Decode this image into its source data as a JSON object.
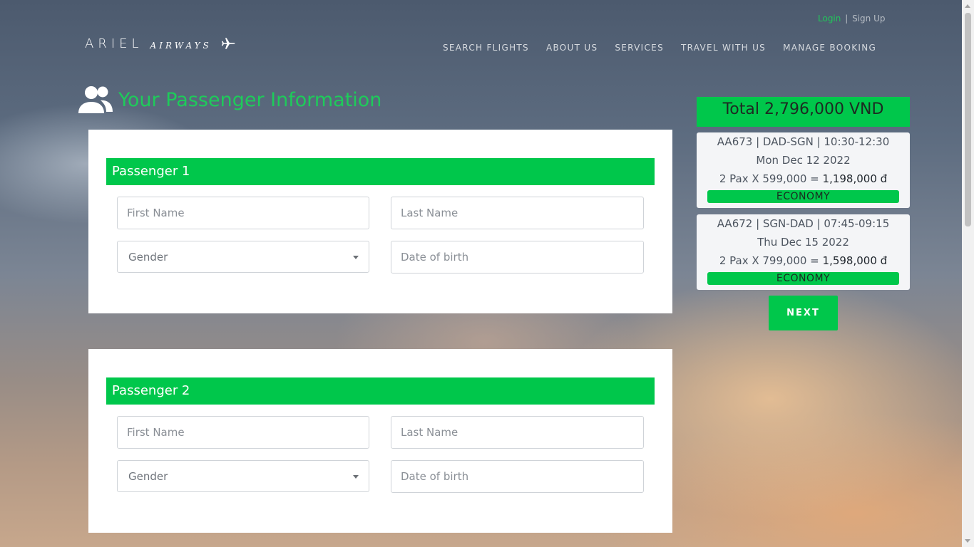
{
  "header": {
    "login": "Login",
    "separator": "|",
    "signup": "Sign Up",
    "logo_main": "ARIEL",
    "logo_sub": "AIRWAYS",
    "logo_icon": "airplane-icon",
    "nav": [
      "SEARCH FLIGHTS",
      "ABOUT US",
      "SERVICES",
      "TRAVEL WITH US",
      "MANAGE BOOKING"
    ]
  },
  "page": {
    "title": "Your Passenger Information",
    "title_icon": "users-icon"
  },
  "passengers": [
    {
      "heading": "Passenger 1",
      "first_name_placeholder": "First Name",
      "last_name_placeholder": "Last Name",
      "gender_selected": "Gender",
      "dob_placeholder": "Date of birth"
    },
    {
      "heading": "Passenger 2",
      "first_name_placeholder": "First Name",
      "last_name_placeholder": "Last Name",
      "gender_selected": "Gender",
      "dob_placeholder": "Date of birth"
    }
  ],
  "summary": {
    "total": "Total 2,796,000 VND",
    "flights": [
      {
        "route": "AA673 | DAD-SGN | 10:30-12:30",
        "date": "Mon Dec 12 2022",
        "fare": "2 Pax X 599,000 =",
        "fare_total": "1,198,000 đ",
        "class": "ECONOMY"
      },
      {
        "route": "AA672 | SGN-DAD | 07:45-09:15",
        "date": "Thu Dec 15 2022",
        "fare": "2 Pax X 799,000 =",
        "fare_total": "1,598,000 đ",
        "class": "ECONOMY"
      }
    ],
    "next_label": "NEXT"
  },
  "colors": {
    "accent": "#00c74b",
    "title": "#1ecb5a",
    "login": "#21c75a"
  }
}
